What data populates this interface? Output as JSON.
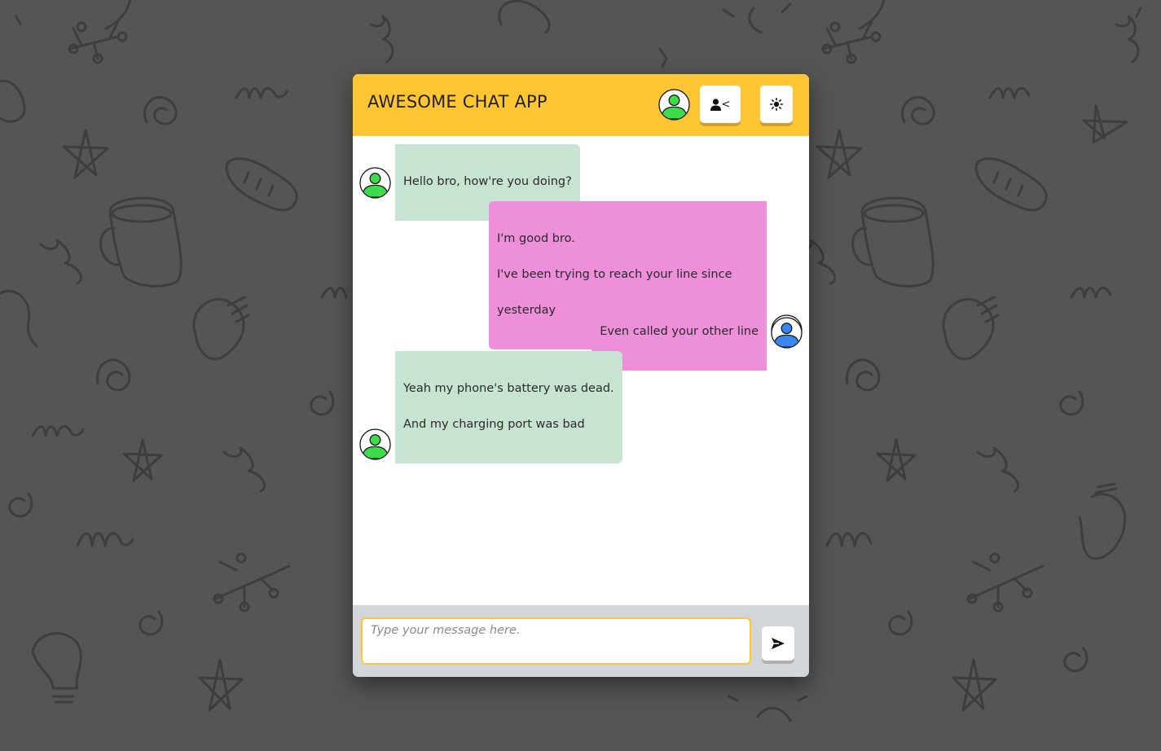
{
  "app": {
    "title": "AWESOME CHAT APP"
  },
  "header": {
    "avatar_icon": "user-avatar-green",
    "switch_user_icon": "user-back-icon",
    "switch_user_glyph": "<",
    "theme_icon": "sun-icon"
  },
  "messages": [
    {
      "side": "incoming",
      "avatar": "green",
      "lines": [
        "Hello bro, how're you doing?"
      ]
    },
    {
      "side": "outgoing",
      "avatar": "blue",
      "lines": [
        "I'm good bro.",
        "I've been trying to reach your line since",
        "yesterday"
      ]
    },
    {
      "side": "outgoing",
      "avatar": "blue",
      "lines": [
        "Even called your other line"
      ]
    },
    {
      "side": "incoming",
      "avatar": "green",
      "lines": [
        "Yeah my phone's battery was dead.",
        "And my charging port was bad"
      ]
    }
  ],
  "composer": {
    "value": "",
    "placeholder": "Type your message here.",
    "send_icon": "send-icon"
  },
  "colors": {
    "header": "#ffc633",
    "incoming_bubble": "#c7e3d1",
    "outgoing_bubble": "#ee8fda",
    "footer": "#d3d6d8",
    "background": "#555555",
    "avatar_green": "#3ddc4a",
    "avatar_blue": "#3a86f0"
  }
}
